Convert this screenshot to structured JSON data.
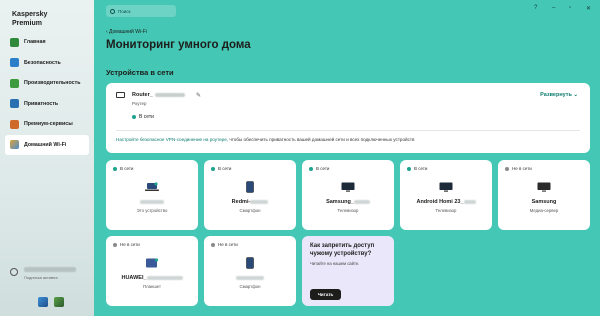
{
  "app": {
    "brand_line1": "Kaspersky",
    "brand_line2": "Premium"
  },
  "sidebar": {
    "items": [
      {
        "label": "Главная",
        "icon": "home-icon",
        "color": "#2f8a3c"
      },
      {
        "label": "Безопасность",
        "icon": "shield-icon",
        "color": "#2b7fc9"
      },
      {
        "label": "Производительность",
        "icon": "speedometer-icon",
        "color": "#3d9a3f"
      },
      {
        "label": "Приватность",
        "icon": "privacy-icon",
        "color": "#2a6fb0"
      },
      {
        "label": "Премиум-сервисы",
        "icon": "premium-icon",
        "color": "#d06a2a"
      },
      {
        "label": "Домашний Wi-Fi",
        "icon": "wifi-home-icon",
        "color": "#6b6b6b"
      }
    ],
    "account_subtitle": "Подписка активна"
  },
  "search": {
    "placeholder": "Поиск"
  },
  "window_controls": {
    "help": "?",
    "minimize": "–",
    "maximize": "▫",
    "close": "✕"
  },
  "main": {
    "breadcrumb": "‹  Домашний Wi-Fi",
    "title": "Мониторинг умного дома",
    "section_title": "Устройства в сети",
    "router": {
      "name": "Router_",
      "type": "Роутер",
      "status": "В сети",
      "expand_label": "Развернуть  ⌄",
      "hint_link": "Настройте безопасное VPN-соединение на роутере,",
      "hint_rest": " чтобы обеспечить приватность вашей домашней сети и всех подключенных устройств"
    },
    "devices": [
      {
        "status": "В сети",
        "online": true,
        "name": "",
        "type": "Это устройство",
        "icon": "laptop-icon"
      },
      {
        "status": "В сети",
        "online": true,
        "name": "Redmi-",
        "type": "Смартфон",
        "icon": "smartphone-icon"
      },
      {
        "status": "В сети",
        "online": true,
        "name": "Samsung_",
        "type": "Телевизор",
        "icon": "tv-icon"
      },
      {
        "status": "В сети",
        "online": true,
        "name": "Android Homi 23_",
        "type": "Телевизор",
        "icon": "tv-icon"
      },
      {
        "status": "Не в сети",
        "online": false,
        "name": "Samsung",
        "type": "Медиа-сервер",
        "icon": "media-server-icon"
      },
      {
        "status": "Не в сети",
        "online": false,
        "name": "HUAWEI_",
        "type": "Планшет",
        "icon": "tablet-icon"
      },
      {
        "status": "Не в сети",
        "online": false,
        "name": "",
        "type": "Смартфон",
        "icon": "smartphone-icon"
      }
    ],
    "promo": {
      "title": "Как запретить доступ чужому устройству?",
      "subtitle": "Читайте на нашем сайте.",
      "button": "Читать"
    }
  }
}
